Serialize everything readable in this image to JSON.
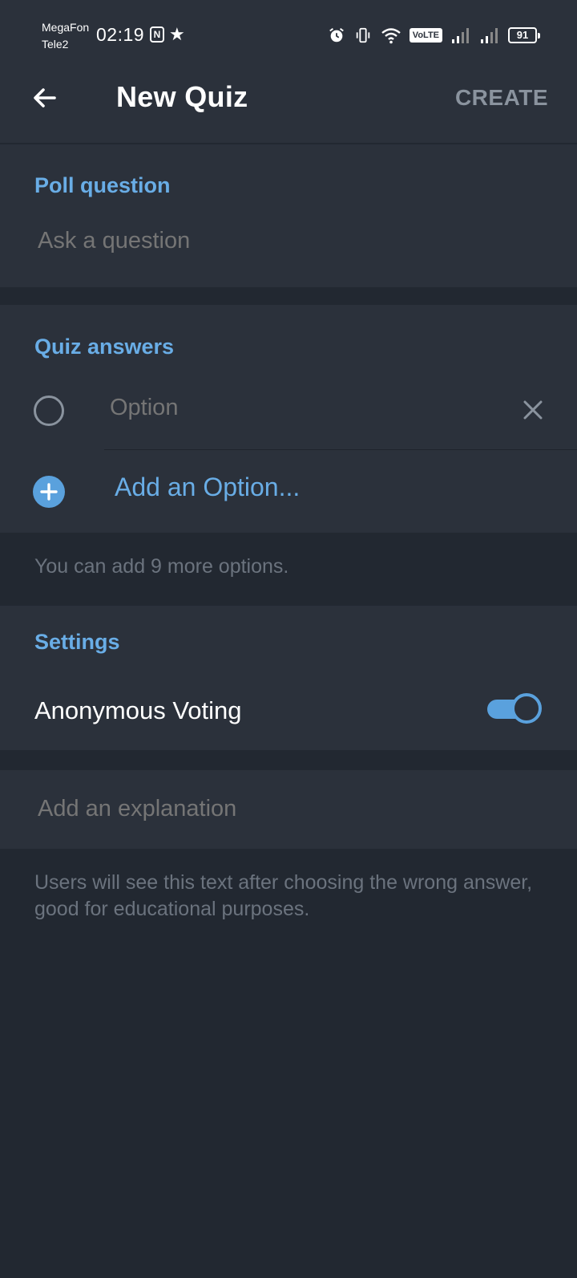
{
  "status_bar": {
    "carrier_primary": "MegaFon",
    "carrier_secondary": "Tele2",
    "time": "02:19",
    "nfc_glyph": "N",
    "volte_label": "VoLTE",
    "battery_level": "91",
    "icons": [
      "alarm-icon",
      "vibrate-icon",
      "wifi-icon",
      "signal-icon",
      "battery-icon"
    ]
  },
  "app_bar": {
    "title": "New Quiz",
    "create_label": "CREATE",
    "back_icon": "arrow-left-icon"
  },
  "poll_question": {
    "header": "Poll question",
    "placeholder": "Ask a question"
  },
  "quiz_answers": {
    "header": "Quiz answers",
    "options": [
      {
        "placeholder": "Option",
        "selected": false
      }
    ],
    "add_option_label": "Add an Option...",
    "hint": "You can add 9 more options."
  },
  "settings": {
    "header": "Settings",
    "anonymous_voting_label": "Anonymous Voting",
    "anonymous_voting_enabled": true
  },
  "explanation": {
    "placeholder": "Add an explanation",
    "hint": "Users will see this text after choosing the wrong answer, good for educational purposes."
  },
  "colors": {
    "background": "#222831",
    "card": "#2b313b",
    "accent": "#69ade6",
    "toggle_accent": "#5aa1dd",
    "muted_text": "#8a939e",
    "hint_text": "#6b737e"
  }
}
